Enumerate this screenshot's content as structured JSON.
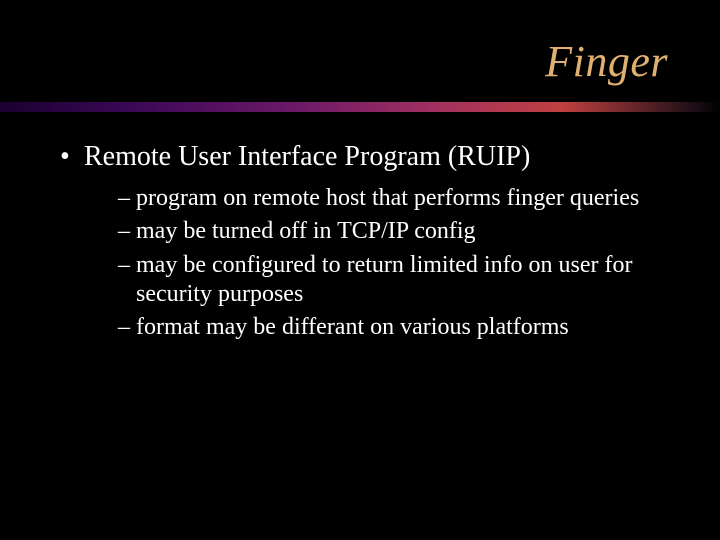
{
  "title": "Finger",
  "bullets": {
    "level1": {
      "mark": "•",
      "text": "Remote User Interface Program (RUIP)"
    },
    "subitems": [
      {
        "dash": "–",
        "text": "program on remote host that performs finger queries"
      },
      {
        "dash": "–",
        "text": "may be turned off in TCP/IP config"
      },
      {
        "dash": "–",
        "text": "may be configured to return limited info on user for security purposes"
      },
      {
        "dash": "–",
        "text": "format may be differant on various platforms"
      }
    ]
  }
}
